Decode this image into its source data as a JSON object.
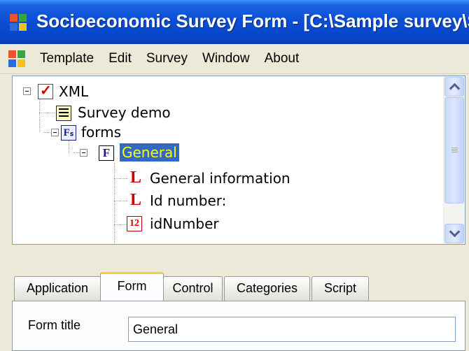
{
  "window": {
    "title": "Socioeconomic Survey Form - [C:\\Sample survey\\S"
  },
  "app_icon_colors": [
    "#e8542e",
    "#3aa53a",
    "#2d6bd8",
    "#f2c318"
  ],
  "menu": {
    "items": [
      {
        "label": "Template"
      },
      {
        "label": "Edit"
      },
      {
        "label": "Survey"
      },
      {
        "label": "Window"
      },
      {
        "label": "About"
      }
    ]
  },
  "tree": {
    "nodes": [
      {
        "label": "XML",
        "icon": "xml-check-icon"
      },
      {
        "label": "Survey demo",
        "icon": "survey-list-icon"
      },
      {
        "label": "forms",
        "icon": "forms-icon",
        "icon_text": "Fₛ"
      },
      {
        "label": "General",
        "icon": "form-icon",
        "icon_text": "F",
        "selected": true
      },
      {
        "label": "General information",
        "icon": "label-icon",
        "icon_text": "L"
      },
      {
        "label": "Id number:",
        "icon": "label-icon",
        "icon_text": "L"
      },
      {
        "label": "idNumber",
        "icon": "numeric-field-icon",
        "icon_text": "12"
      }
    ],
    "selection_color": "#316ac5",
    "selection_text_color": "#ffff00"
  },
  "tabs": {
    "items": [
      {
        "label": "Application",
        "active": false
      },
      {
        "label": "Form",
        "active": true
      },
      {
        "label": "Control",
        "active": false
      },
      {
        "label": "Categories",
        "active": false
      },
      {
        "label": "Script",
        "active": false
      }
    ]
  },
  "form": {
    "title_label": "Form title",
    "title_value": "General"
  }
}
